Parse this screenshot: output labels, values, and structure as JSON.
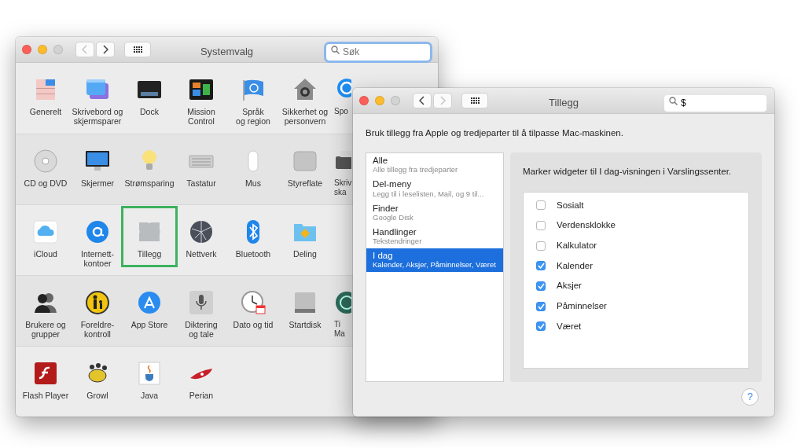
{
  "back_window": {
    "title": "Systemvalg",
    "nav": {
      "back_enabled": false,
      "forward_enabled": true
    },
    "search": {
      "placeholder": "Søk"
    },
    "rows": [
      {
        "items": [
          {
            "label": "Generelt",
            "highlighted": false
          },
          {
            "label": "Skrivebord og\nskjermsparer",
            "highlighted": false
          },
          {
            "label": "Dock",
            "highlighted": false
          },
          {
            "label": "Mission\nControl",
            "highlighted": false
          },
          {
            "label": "Språk\nog region",
            "highlighted": false
          },
          {
            "label": "Sikkerhet og\npersonvern",
            "highlighted": false
          },
          {
            "label": "Spo",
            "highlighted": false
          }
        ]
      },
      {
        "items": [
          {
            "label": "CD og DVD",
            "highlighted": false
          },
          {
            "label": "Skjermer",
            "highlighted": false
          },
          {
            "label": "Strømsparing",
            "highlighted": false
          },
          {
            "label": "Tastatur",
            "highlighted": false
          },
          {
            "label": "Mus",
            "highlighted": false
          },
          {
            "label": "Styreflate",
            "highlighted": false
          },
          {
            "label": "Skriv\nska",
            "highlighted": false
          }
        ]
      },
      {
        "items": [
          {
            "label": "iCloud",
            "highlighted": false
          },
          {
            "label": "Internett-\nkontoer",
            "highlighted": false
          },
          {
            "label": "Tillegg",
            "highlighted": true
          },
          {
            "label": "Nettverk",
            "highlighted": false
          },
          {
            "label": "Bluetooth",
            "highlighted": false
          },
          {
            "label": "Deling",
            "highlighted": false
          }
        ]
      },
      {
        "items": [
          {
            "label": "Brukere og\ngrupper",
            "highlighted": false
          },
          {
            "label": "Foreldre-\nkontroll",
            "highlighted": false
          },
          {
            "label": "App Store",
            "highlighted": false
          },
          {
            "label": "Diktering\nog tale",
            "highlighted": false
          },
          {
            "label": "Dato og tid",
            "highlighted": false
          },
          {
            "label": "Startdisk",
            "highlighted": false
          },
          {
            "label": "Ti\nMa",
            "highlighted": false
          }
        ]
      },
      {
        "items": [
          {
            "label": "Flash Player",
            "highlighted": false
          },
          {
            "label": "Growl",
            "highlighted": false
          },
          {
            "label": "Java",
            "highlighted": false
          },
          {
            "label": "Perian",
            "highlighted": false
          }
        ]
      }
    ]
  },
  "front_window": {
    "title": "Tillegg",
    "nav": {
      "back_enabled": true,
      "forward_enabled": false
    },
    "search": {
      "value": "$"
    },
    "description": "Bruk tillegg fra Apple og tredjeparter til å tilpasse Mac-maskinen.",
    "categories": [
      {
        "title": "Alle",
        "subtitle": "Alle tillegg fra tredjeparter",
        "selected": false
      },
      {
        "title": "Del-meny",
        "subtitle": "Legg til i leselisten, Mail, og 9 til...",
        "selected": false
      },
      {
        "title": "Finder",
        "subtitle": "Google Disk",
        "selected": false
      },
      {
        "title": "Handlinger",
        "subtitle": "Tekstendringer",
        "selected": false
      },
      {
        "title": "I dag",
        "subtitle": "Kalender, Aksjer, Påminnelser, Været",
        "selected": true
      }
    ],
    "panel": {
      "heading": "Marker widgeter til I dag-visningen i Varslingssenter.",
      "widgets": [
        {
          "label": "Sosialt",
          "checked": false
        },
        {
          "label": "Verdensklokke",
          "checked": false
        },
        {
          "label": "Kalkulator",
          "checked": false
        },
        {
          "label": "Kalender",
          "checked": true
        },
        {
          "label": "Aksjer",
          "checked": true
        },
        {
          "label": "Påminnelser",
          "checked": true
        },
        {
          "label": "Været",
          "checked": true
        }
      ]
    },
    "help": "?"
  }
}
